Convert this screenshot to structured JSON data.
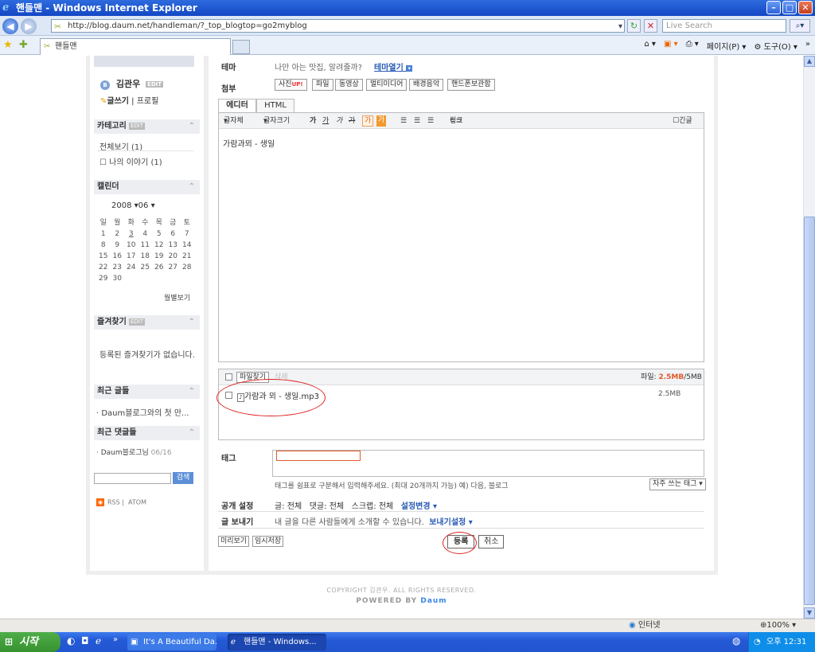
{
  "window": {
    "title": "핸들맨 - Windows Internet Explorer"
  },
  "address": {
    "url": "http://blog.daum.net/handleman/?_top_blogtop=go2myblog",
    "search_placeholder": "Live Search"
  },
  "tab": {
    "title": "핸들맨"
  },
  "command_bar": {
    "page": "페이지(P)",
    "tools": "도구(O)"
  },
  "sidebar": {
    "profile_name": "김관우",
    "edit_badge": "EDIT",
    "write": "글쓰기",
    "profile_link": "프로필",
    "categories_title": "카테고리",
    "category_all": "전체보기 (1)",
    "category_story": "나의 이야기 (1)",
    "calendar_title": "캘린더",
    "year": "2008",
    "month": "06",
    "weekdays": [
      "일",
      "월",
      "화",
      "수",
      "목",
      "금",
      "토"
    ],
    "days": [
      "1",
      "2",
      "3",
      "4",
      "5",
      "6",
      "7",
      "8",
      "9",
      "10",
      "11",
      "12",
      "13",
      "14",
      "15",
      "16",
      "17",
      "18",
      "19",
      "20",
      "21",
      "22",
      "23",
      "24",
      "25",
      "26",
      "27",
      "28",
      "29",
      "30"
    ],
    "monthly_view": "월별보기",
    "bookmarks_title": "즐겨찾기",
    "bookmarks_empty": "등록된 즐겨찾기가 없습니다.",
    "recent_posts_title": "최근 글들",
    "recent_post": "· Daum블로그와의 첫 만...",
    "recent_comments_title": "최근 댓글들",
    "recent_comment": "· Daum블로그님",
    "recent_comment_date": "06/16",
    "search_button": "검색",
    "rss": "RSS",
    "atom": "ATOM"
  },
  "editor": {
    "theme_label": "테마",
    "theme_text": "나만 아는 맛집, 알려줄까?",
    "theme_open": "테마열기",
    "attach_label": "첨부",
    "attach_buttons": [
      "사진",
      "파일",
      "동영상",
      "멀티미디어",
      "배경음악",
      "핸드폰보관함"
    ],
    "photo_badge": "UP!",
    "tab_editor": "에디터",
    "tab_html": "HTML",
    "font_face": "글자체",
    "font_size": "글자크기",
    "format_buttons": [
      "가",
      "가",
      "가",
      "가",
      "가",
      "가"
    ],
    "link": "링크",
    "long_post": "긴글",
    "content": "가람과뫼 - 생일"
  },
  "files": {
    "find_button": "파일찾기",
    "delete": "삭제",
    "quota_label": "파일:",
    "quota_used": "2.5MB",
    "quota_total": "/5MB",
    "filename": "가람과 뫼 - 생일.mp3",
    "filesize": "2.5MB"
  },
  "tags": {
    "label": "태그",
    "help": "태그를 쉼표로 구분해서 입력해주세요. (최대 20개까지 가능) 예) 다음, 블로그",
    "frequent_button": "자주 쓰는 태그"
  },
  "publish": {
    "label": "공개 설정",
    "post_label": "글:",
    "post_value": "전체",
    "comment_label": "댓글:",
    "comment_value": "전체",
    "scrap_label": "스크랩:",
    "scrap_value": "전체",
    "change": "설정변경"
  },
  "send": {
    "label": "글 보내기",
    "text": "내 글을 다른 사람들에게 소개할 수 있습니다.",
    "link": "보내기설정"
  },
  "actions": {
    "preview": "미리보기",
    "temp_save": "임시저장",
    "submit": "등록",
    "cancel": "취소"
  },
  "footer": {
    "copyright": "COPYRIGHT 김관우. ALL RIGHTS RESERVED.",
    "powered": "POWERED BY",
    "brand": "Daum"
  },
  "status": {
    "zone": "인터넷",
    "zoom": "100%"
  },
  "taskbar": {
    "start": "시작",
    "task1": "It's A Beautiful Da...",
    "task2": "핸들맨 - Windows...",
    "clock": "오후 12:31"
  },
  "colors": {
    "accent": "#2a5bb5",
    "highlight": "#e05a2a",
    "annotation": "#dd2222"
  }
}
